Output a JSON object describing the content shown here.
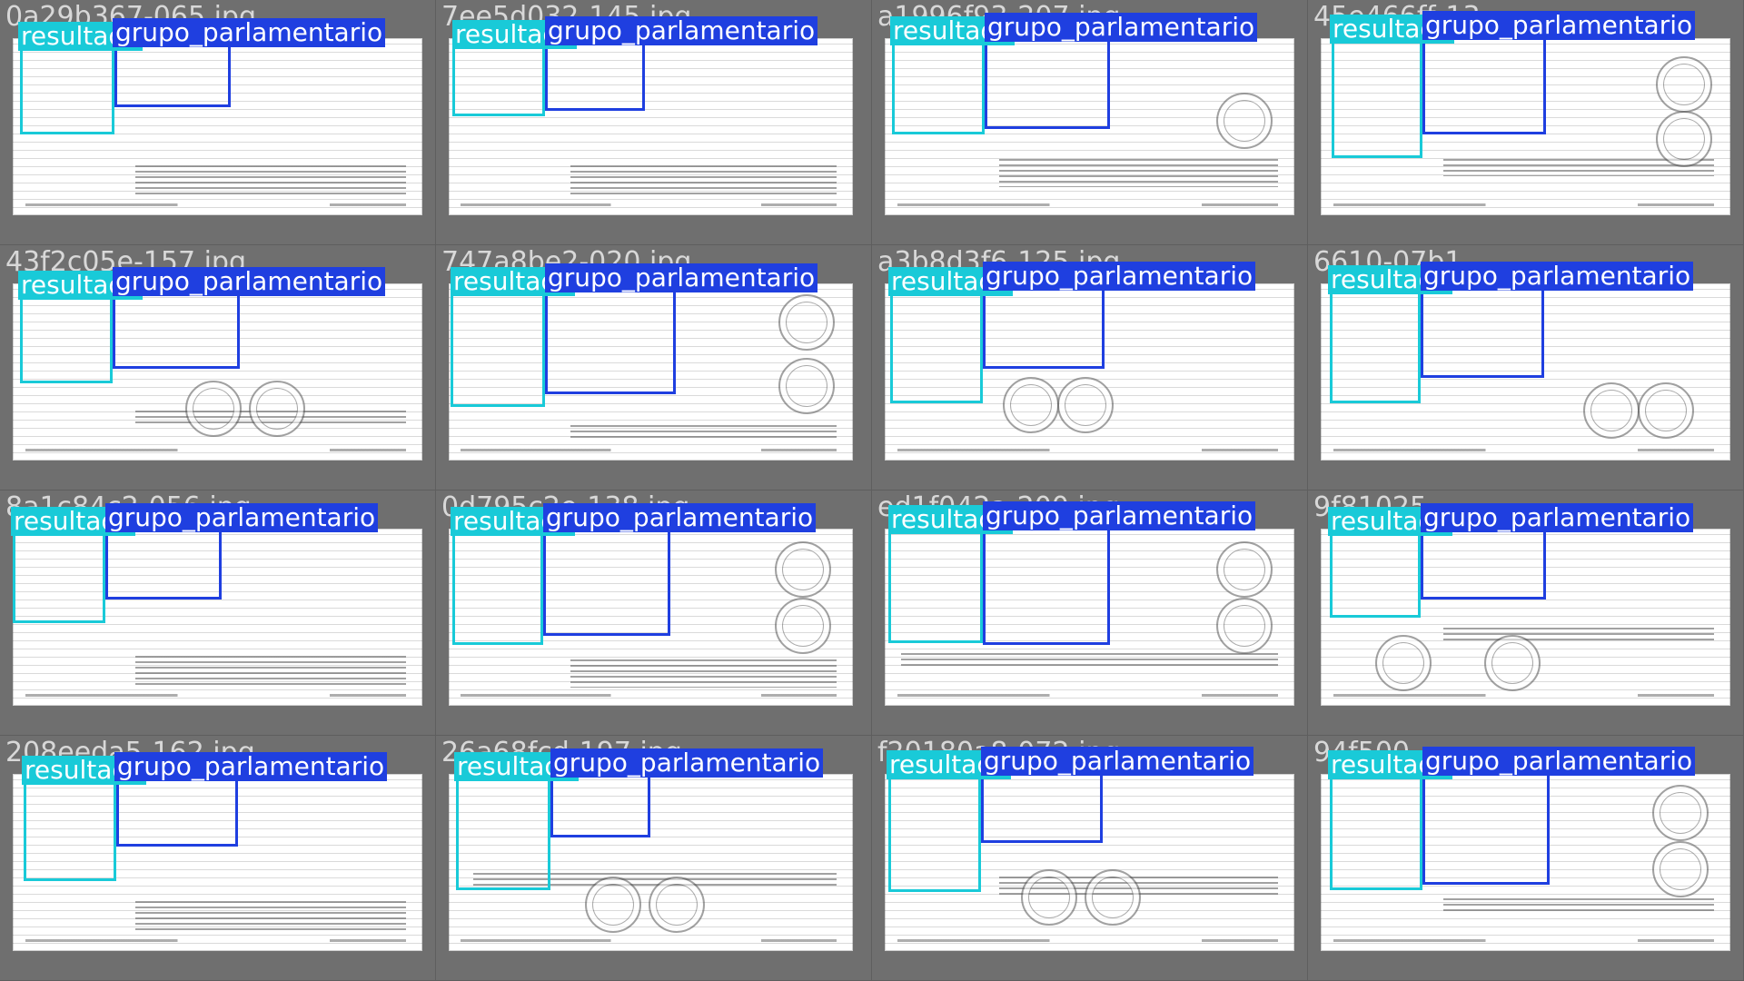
{
  "labels": {
    "resultado": "resultado",
    "grupo": "grupo_parlamentario"
  },
  "colors": {
    "resultado": "#19cad8",
    "grupo": "#1f3fe0",
    "background": "#6e6e6e"
  },
  "tiles": [
    {
      "filename": "0a29b367-065.jpg",
      "resultado": "resultado",
      "grupo": "grupo_parlamentario"
    },
    {
      "filename": "7ee5d032-145.jpg",
      "resultado": "resultado",
      "grupo": "grupo_parlamentario"
    },
    {
      "filename": "a1996f93-207.jpg",
      "resultado": "resultado",
      "grupo": "grupo_parlamentario"
    },
    {
      "filename": "45e466ff-13",
      "resultado": "resultado",
      "grupo": "grupo_parlamentario"
    },
    {
      "filename": "43f2c05e-157.jpg",
      "resultado": "resultado",
      "grupo": "grupo_parlamentario"
    },
    {
      "filename": "747a8be2-020.jpg",
      "resultado": "resultado",
      "grupo": "grupo_parlamentario"
    },
    {
      "filename": "a3b8d3f6-125.jpg",
      "resultado": "resultado",
      "grupo": "grupo_parlamentario"
    },
    {
      "filename": "6610-07b1",
      "resultado": "resultado",
      "grupo": "grupo_parlamentario"
    },
    {
      "filename": "8a1c84c2-056.jpg",
      "resultado": "resultado",
      "grupo": "grupo_parlamentario"
    },
    {
      "filename": "0d795c2e-138.jpg",
      "resultado": "resultado",
      "grupo": "grupo_parlamentario"
    },
    {
      "filename": "ed1f042a-200.jpg",
      "resultado": "resultado",
      "grupo": "grupo_parlamentario"
    },
    {
      "filename": "9f81025",
      "resultado": "resultado",
      "grupo": "grupo_parlamentario"
    },
    {
      "filename": "208eeda5-162.jpg",
      "resultado": "resultado",
      "grupo": "grupo_parlamentario"
    },
    {
      "filename": "26a68fcd-197.jpg",
      "resultado": "resultado",
      "grupo": "grupo_parlamentario"
    },
    {
      "filename": "f20180a8-072.jpg",
      "resultado": "resultado",
      "grupo": "grupo_parlamentario"
    },
    {
      "filename": "94f500",
      "resultado": "resultado",
      "grupo": "grupo_parlamentario"
    }
  ]
}
